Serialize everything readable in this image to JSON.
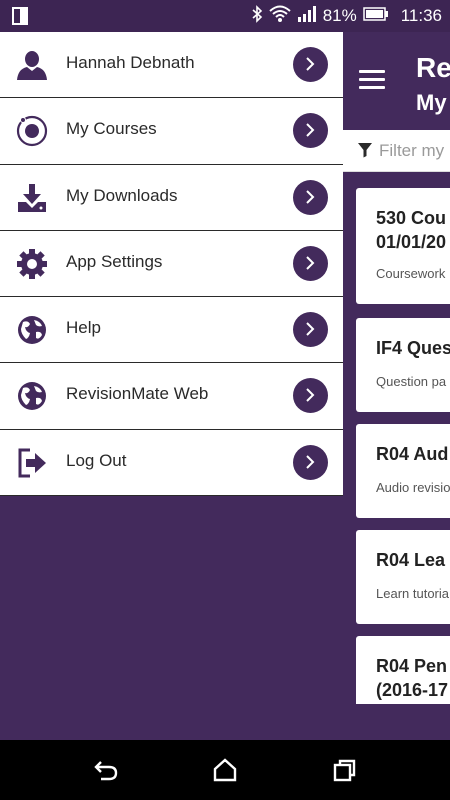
{
  "status_bar": {
    "battery_percent": "81%",
    "time": "11:36",
    "icons": [
      "phone-icon",
      "bluetooth-icon",
      "wifi-icon",
      "signal-icon",
      "battery-icon"
    ]
  },
  "main": {
    "title": "Re",
    "subtitle": "My",
    "filter_placeholder": "Filter my",
    "cards": [
      {
        "title_line1": "530 Cou",
        "title_line2": "01/01/20",
        "subtitle": "Coursework"
      },
      {
        "title_line1": "IF4 Ques",
        "title_line2": "",
        "subtitle": "Question pa"
      },
      {
        "title_line1": "R04 Aud",
        "title_line2": "",
        "subtitle": "Audio revisio"
      },
      {
        "title_line1": "R04 Lea",
        "title_line2": "",
        "subtitle": "Learn tutoria"
      },
      {
        "title_line1": "R04 Pen",
        "title_line2": "(2016-17",
        "subtitle": ""
      }
    ]
  },
  "drawer": {
    "items": [
      {
        "label": "Hannah Debnath",
        "icon": "person-icon"
      },
      {
        "label": "My Courses",
        "icon": "circle-target-icon"
      },
      {
        "label": "My Downloads",
        "icon": "download-icon"
      },
      {
        "label": "App Settings",
        "icon": "gear-icon"
      },
      {
        "label": "Help",
        "icon": "globe-icon"
      },
      {
        "label": "RevisionMate Web",
        "icon": "globe-icon"
      },
      {
        "label": "Log Out",
        "icon": "logout-icon"
      }
    ]
  },
  "colors": {
    "brand_purple": "#432a5c",
    "status_bar": "#3d2553"
  }
}
